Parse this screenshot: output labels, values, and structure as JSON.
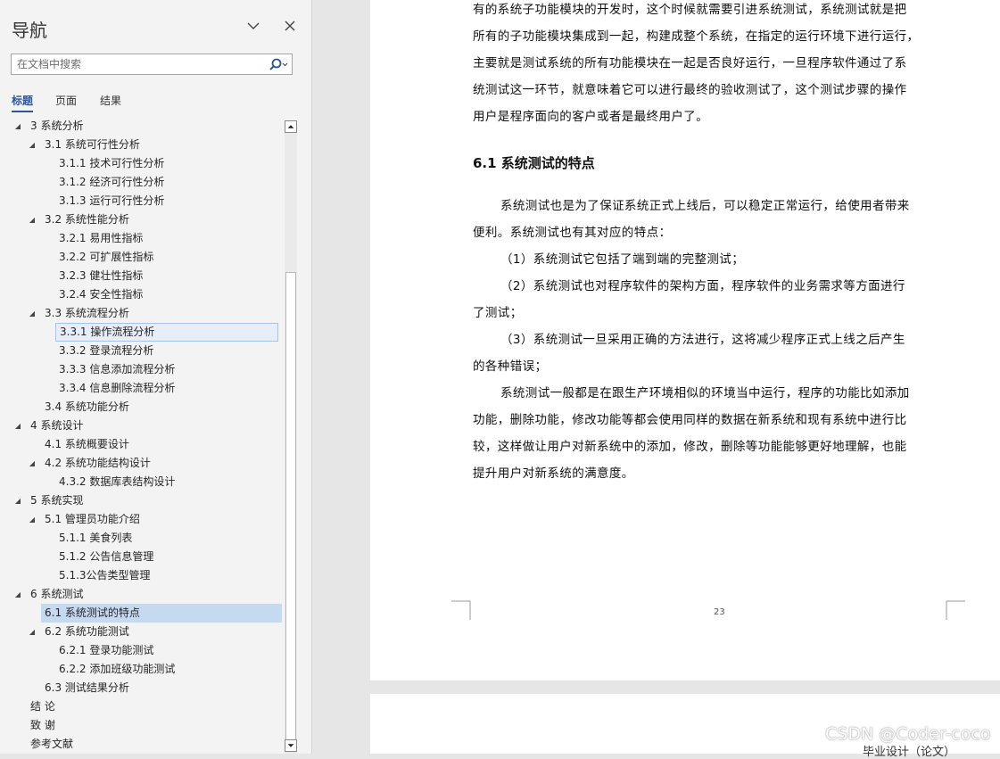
{
  "nav": {
    "title": "导航",
    "search_placeholder": "在文档中搜索",
    "tabs": [
      "标题",
      "页面",
      "结果"
    ],
    "tree": [
      {
        "label": "3 系统分析",
        "level": 1,
        "expanded": true
      },
      {
        "label": "3.1 系统可行性分析",
        "level": 2,
        "expanded": true
      },
      {
        "label": "3.1.1 技术可行性分析",
        "level": 3
      },
      {
        "label": "3.1.2 经济可行性分析",
        "level": 3
      },
      {
        "label": "3.1.3 运行可行性分析",
        "level": 3
      },
      {
        "label": "3.2 系统性能分析",
        "level": 2,
        "expanded": true
      },
      {
        "label": "3.2.1 易用性指标",
        "level": 3
      },
      {
        "label": "3.2.2 可扩展性指标",
        "level": 3
      },
      {
        "label": "3.2.3 健壮性指标",
        "level": 3
      },
      {
        "label": "3.2.4 安全性指标",
        "level": 3
      },
      {
        "label": "3.3 系统流程分析",
        "level": 2,
        "expanded": true
      },
      {
        "label": "3.3.1 操作流程分析",
        "level": 3,
        "hover": true
      },
      {
        "label": "3.3.2 登录流程分析",
        "level": 3
      },
      {
        "label": "3.3.3 信息添加流程分析",
        "level": 3
      },
      {
        "label": "3.3.4 信息删除流程分析",
        "level": 3
      },
      {
        "label": "3.4 系统功能分析",
        "level": 2
      },
      {
        "label": "4 系统设计",
        "level": 1,
        "expanded": true
      },
      {
        "label": "4.1 系统概要设计",
        "level": 2
      },
      {
        "label": "4.2 系统功能结构设计",
        "level": 2,
        "expanded": true
      },
      {
        "label": "4.3.2 数据库表结构设计",
        "level": 3
      },
      {
        "label": "5 系统实现",
        "level": 1,
        "expanded": true
      },
      {
        "label": "5.1 管理员功能介绍",
        "level": 2,
        "expanded": true
      },
      {
        "label": "5.1.1 美食列表",
        "level": 3
      },
      {
        "label": "5.1.2 公告信息管理",
        "level": 3
      },
      {
        "label": "5.1.3公告类型管理",
        "level": 3
      },
      {
        "label": "6 系统测试",
        "level": 1,
        "expanded": true
      },
      {
        "label": "6.1  系统测试的特点",
        "level": 2,
        "selected": true
      },
      {
        "label": "6.2  系统功能测试",
        "level": 2,
        "expanded": true
      },
      {
        "label": "6.2.1 登录功能测试",
        "level": 3
      },
      {
        "label": "6.2.2 添加班级功能测试",
        "level": 3
      },
      {
        "label": "6.3 测试结果分析",
        "level": 2
      },
      {
        "label": "结  论",
        "level": 1
      },
      {
        "label": "致  谢",
        "level": 1
      },
      {
        "label": "参考文献",
        "level": 1
      }
    ]
  },
  "doc": {
    "intro_lines": [
      "有的系统子功能模块的开发时，这个时候就需要引进系统测试，系统测试就是把",
      "所有的子功能模块集成到一起，构建成整个系统，在指定的运行环境下进行运行，",
      "主要就是测试系统的所有功能模块在一起是否良好运行，一旦程序软件通过了系",
      "统测试这一环节，就意味着它可以进行最终的验收测试了，这个测试步骤的操作",
      "用户是程序面向的客户或者是最终用户了。"
    ],
    "heading": "6.1  系统测试的特点",
    "body_lines": [
      {
        "text": "系统测试也是为了保证系统正式上线后，可以稳定正常运行，给使用者带来",
        "indent": true
      },
      {
        "text": "便利。系统测试也有其对应的特点：",
        "indent": false
      },
      {
        "text": "（1）系统测试它包括了端到端的完整测试；",
        "indent": true
      },
      {
        "text": "（2）系统测试也对程序软件的架构方面，程序软件的业务需求等方面进行",
        "indent": true
      },
      {
        "text": "了测试；",
        "indent": false
      },
      {
        "text": "（3）系统测试一旦采用正确的方法进行，这将减少程序正式上线之后产生",
        "indent": true
      },
      {
        "text": "的各种错误；",
        "indent": false
      },
      {
        "text": "系统测试一般都是在跟生产环境相似的环境当中运行，程序的功能比如添加",
        "indent": true
      },
      {
        "text": "功能，删除功能，修改功能等都会使用同样的数据在新系统和现有系统中进行比",
        "indent": false
      },
      {
        "text": "较，这样做让用户对新系统中的添加，修改，删除等功能能够更好地理解，也能",
        "indent": false
      },
      {
        "text": "提升用户对新系统的满意度。",
        "indent": false
      }
    ],
    "page_number": "23",
    "next_page_footer": "毕业设计（论文）"
  },
  "watermark": "CSDN @Coder-coco",
  "colors": {
    "accent": "#2b579a",
    "selected": "#c5d9f1"
  }
}
